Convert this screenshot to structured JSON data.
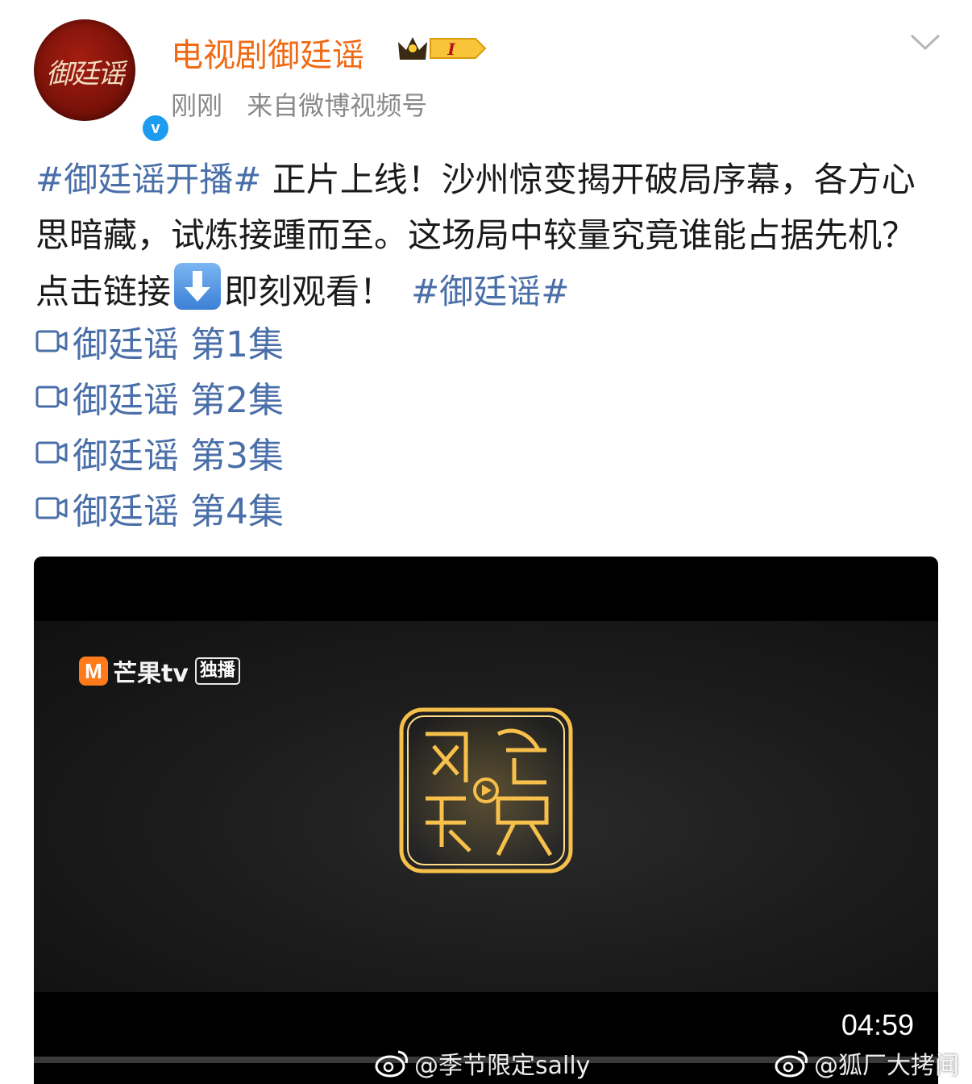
{
  "header": {
    "avatar_text": "御廷谣",
    "user_name": "电视剧御廷谣",
    "vip_badge": "I",
    "timestamp": "刚刚",
    "source": "来自微博视频号"
  },
  "post": {
    "hashtag_open": "#御廷谣开播#",
    "body": " 正片上线！沙州惊变揭开破局序幕，各方心思暗藏，试炼接踵而至。这场局中较量究竟谁能占据先机？点击链接",
    "after_emoji": "即刻观看！",
    "hashtag_close": "#御廷谣#"
  },
  "episodes": [
    {
      "label": "御廷谣 第1集"
    },
    {
      "label": "御廷谣 第2集"
    },
    {
      "label": "御廷谣 第3集"
    },
    {
      "label": "御廷谣 第4集"
    }
  ],
  "video": {
    "brand_text": "芒果tv",
    "brand_badge": "独播",
    "duration": "04:59",
    "progress": 0
  },
  "watermarks": [
    {
      "text": "@季节限定sally"
    },
    {
      "text": "@狐厂大拷间"
    }
  ],
  "colors": {
    "user_name": "#f06a14",
    "link": "#4a6fa8",
    "meta": "#8a8a8a",
    "verified": "#1d9bf0"
  }
}
